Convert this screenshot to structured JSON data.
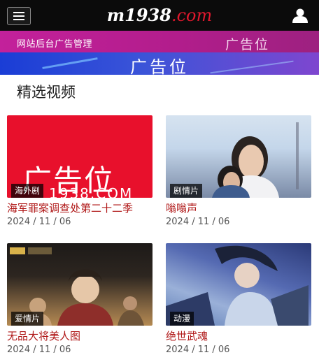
{
  "header": {
    "logo_main": "m1938",
    "logo_tld": ".com"
  },
  "banner": {
    "admin_text": "网站后台广告管理",
    "ad_slot_right": "广告位",
    "ad_slot_center": "广告位"
  },
  "section": {
    "title": "精选视频"
  },
  "videos": [
    {
      "title": "海军罪案调查处第二十二季",
      "date": "2024 / 11 / 06",
      "tag": "海外剧",
      "thumb_text": "广告位",
      "thumb_url": "1938.COM"
    },
    {
      "title": "嗡嗡声",
      "date": "2024 / 11 / 06",
      "tag": "剧情片"
    },
    {
      "title": "无品大将美人图",
      "date": "2024 / 11 / 06",
      "tag": "爱情片"
    },
    {
      "title": "绝世武魂",
      "date": "2024 / 11 / 06",
      "tag": "动漫"
    }
  ],
  "colors": {
    "title_red": "#b01818",
    "topbar": "#0b0b0b",
    "banner_pink": "#b21d8c",
    "banner_blue": "#3b54d8"
  }
}
